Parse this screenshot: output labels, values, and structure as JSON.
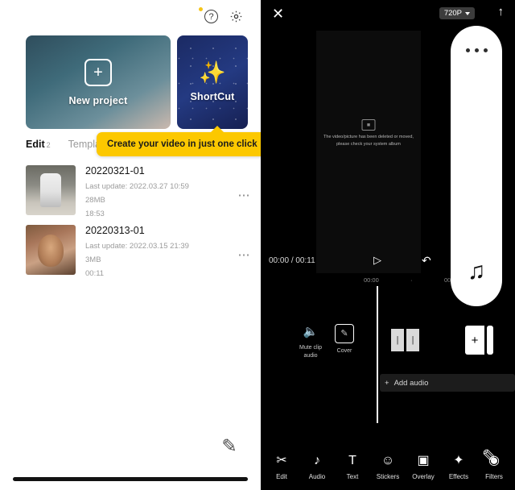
{
  "left": {
    "icons": {
      "help": "?",
      "gear": "gear-icon"
    },
    "cards": [
      {
        "label": "New project",
        "icon": "plus-icon"
      },
      {
        "label": "ShortCut",
        "icon": "magic-wand-icon"
      }
    ],
    "tabs": [
      {
        "label": "Edit",
        "count": "2",
        "active": true
      },
      {
        "label": "Templates",
        "count": "",
        "active": false
      }
    ],
    "tooltip": "Create your video in just one click",
    "projects": [
      {
        "title": "20220321-01",
        "updated": "Last update: 2022.03.27 10:59",
        "size": "28MB",
        "duration": "18:53",
        "more": "⋯"
      },
      {
        "title": "20220313-01",
        "updated": "Last update: 2022.03.15 21:39",
        "size": "3MB",
        "duration": "00:11",
        "more": "⋯"
      }
    ],
    "fab": "pencil-icon"
  },
  "right": {
    "topbar": {
      "close": "✕",
      "resolution": "720P",
      "export": "↑"
    },
    "preview": {
      "message": "The video/picture has been deleted or moved,\nplease check your system album",
      "broken_icon": "broken-image-icon"
    },
    "player": {
      "current_time": "00:00",
      "separator": "/",
      "total_time": "00:11",
      "play": "▷",
      "undo": "↶"
    },
    "ruler": {
      "ticks": [
        "00:00",
        "·",
        "00:05"
      ]
    },
    "tools": [
      {
        "label": "Mute clip\naudio",
        "icon": "mute-icon"
      },
      {
        "label": "Cover",
        "icon": "cover-pencil-icon"
      }
    ],
    "clips": {
      "split_marks": [
        "|",
        "|"
      ],
      "add_button": "+"
    },
    "add_audio": {
      "icon": "+",
      "label": "Add audio"
    },
    "bottom_nav": [
      {
        "label": "Edit",
        "icon": "scissors-icon"
      },
      {
        "label": "Audio",
        "icon": "music-note-icon"
      },
      {
        "label": "Text",
        "icon": "text-T-icon"
      },
      {
        "label": "Stickers",
        "icon": "smiley-icon"
      },
      {
        "label": "Overlay",
        "icon": "layers-icon"
      },
      {
        "label": "Effects",
        "icon": "sparkle-icon"
      },
      {
        "label": "Filters",
        "icon": "filter-icon"
      }
    ],
    "float_pill": {
      "dots": "•••",
      "note": "♫"
    },
    "pencil": "pencil-icon"
  },
  "colors": {
    "tooltip_bg": "#fcc800",
    "panel_dark": "#000000",
    "badge_yellow": "#f5c518"
  }
}
